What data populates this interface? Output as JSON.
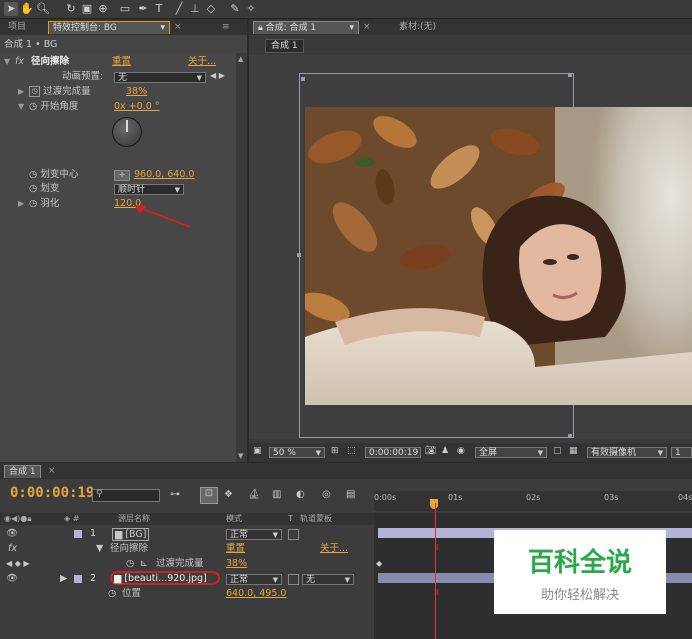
{
  "toolbar": {
    "icons": [
      "arrow-tool-icon",
      "hand-tool-icon",
      "zoom-tool-icon",
      "rotate-tool-icon",
      "camera-tool-icon",
      "pan-behind-tool-icon",
      "rectangle-tool-icon",
      "pen-tool-icon",
      "type-tool-icon",
      "brush-tool-icon",
      "clone-stamp-tool-icon",
      "eraser-tool-icon",
      "roto-brush-tool-icon",
      "puppet-tool-icon"
    ]
  },
  "left_panel": {
    "tab_project": "项目",
    "tab_effect_controls": "特效控制台: BG",
    "breadcrumb": "合成 1 • BG",
    "effect_name": "径向擦除",
    "reset": "重置",
    "about": "关于...",
    "preset_label": "动画预置:",
    "preset_value": "无",
    "props": {
      "transition_completion_label": "过渡完成量",
      "transition_completion_value": "38%",
      "start_angle_label": "开始角度",
      "start_angle_value": "0x +0.0 °",
      "wipe_center_label": "划变中心",
      "wipe_center_value": "960.0, 640.0",
      "wipe_label": "划变",
      "wipe_value": "顺时针",
      "feather_label": "羽化",
      "feather_value": "120.0"
    }
  },
  "comp_panel": {
    "tab_comp": "合成: 合成 1",
    "tab_footage": "素材:(无)",
    "sub_tab": "合成 1",
    "zoom": "50 %",
    "timecode": "0:00:00:19",
    "resolution": "全屏",
    "camera": "有效摄像机",
    "view_count": "1"
  },
  "timeline": {
    "tab": "合成 1",
    "timecode": "0:00:00:19",
    "search_placeholder": "",
    "ruler": [
      "0:00s",
      "01s",
      "02s",
      "03s",
      "04s"
    ],
    "col_source": "源层名称",
    "col_mode": "模式",
    "col_t": "T",
    "col_trkmat": "轨道蒙板",
    "layers": [
      {
        "num": "1",
        "name": "[BG]",
        "mode": "正常"
      },
      {
        "num": "2",
        "name": "[beauti...920.jpg]",
        "mode": "正常",
        "trkmat": "无"
      }
    ],
    "fx_label": "fx",
    "effect_name": "径向擦除",
    "effect_reset": "重置",
    "effect_about": "关于...",
    "prop_completion_label": "过渡完成量",
    "prop_completion_value": "38%",
    "prop_position_label": "位置",
    "prop_position_value": "640.0, 495.0"
  },
  "watermark": {
    "title": "百科全说",
    "subtitle": "助你轻松解决"
  },
  "colors": {
    "accent_orange": "#e5a63b",
    "highlight_red": "#d02020",
    "watermark_green": "#2aa84a",
    "layer_bar": "#b3b3d8",
    "playhead": "#e83030"
  }
}
